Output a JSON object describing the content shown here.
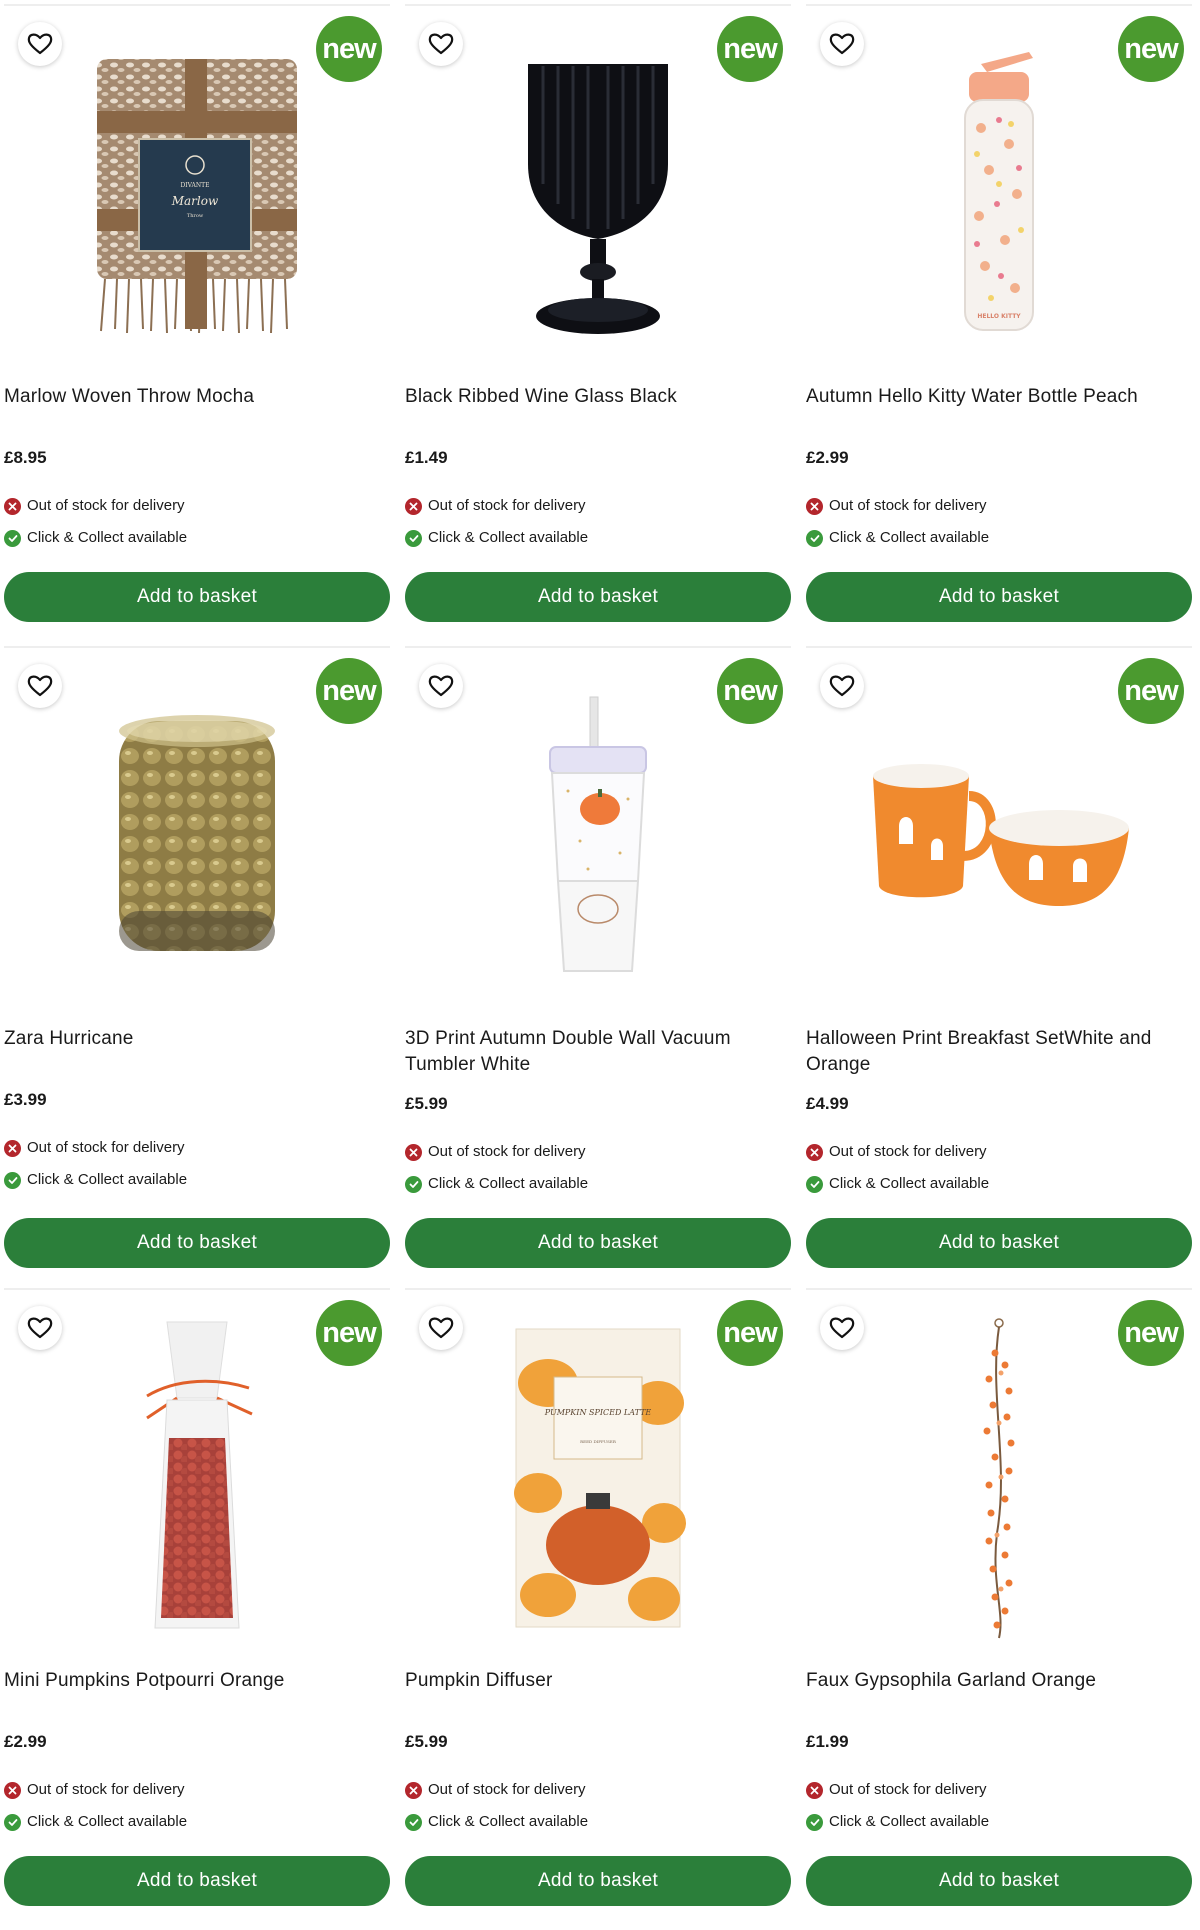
{
  "colors": {
    "badge": "#4b9a2f",
    "button": "#2b7f3a",
    "out_of_stock": "#b3262c",
    "available": "#3a9a3c"
  },
  "products": [
    {
      "title": "Marlow Woven Throw Mocha",
      "price": "£8.95",
      "badge": "new",
      "delivery": "Out of stock for delivery",
      "collect": "Click & Collect available",
      "button": "Add to basket",
      "image": "woven-throw",
      "packaging_brand": "DIVANTE",
      "packaging_name": "Marlow",
      "packaging_type": "Throw"
    },
    {
      "title": "Black Ribbed Wine Glass Black",
      "price": "£1.49",
      "badge": "new",
      "delivery": "Out of stock for delivery",
      "collect": "Click & Collect available",
      "button": "Add to basket",
      "image": "wine-glass"
    },
    {
      "title": "Autumn Hello Kitty Water Bottle Peach",
      "price": "£2.99",
      "badge": "new",
      "delivery": "Out of stock for delivery",
      "collect": "Click & Collect available",
      "button": "Add to basket",
      "image": "water-bottle",
      "bottle_print": "HELLO KITTY"
    },
    {
      "title": "Zara Hurricane",
      "price": "£3.99",
      "badge": "new",
      "delivery": "Out of stock for delivery",
      "collect": "Click & Collect available",
      "button": "Add to basket",
      "image": "hurricane-glass"
    },
    {
      "title": "3D Print Autumn Double Wall Vacuum Tumbler White",
      "price": "£5.99",
      "badge": "new",
      "delivery": "Out of stock for delivery",
      "collect": "Click & Collect available",
      "button": "Add to basket",
      "image": "tumbler"
    },
    {
      "title": "Halloween Print Breakfast SetWhite and Orange",
      "price": "£4.99",
      "badge": "new",
      "delivery": "Out of stock for delivery",
      "collect": "Click & Collect available",
      "button": "Add to basket",
      "image": "breakfast-set"
    },
    {
      "title": "Mini Pumpkins Potpourri Orange",
      "price": "£2.99",
      "badge": "new",
      "delivery": "Out of stock for delivery",
      "collect": "Click & Collect available",
      "button": "Add to basket",
      "image": "potpourri-bag"
    },
    {
      "title": "Pumpkin Diffuser",
      "price": "£5.99",
      "badge": "new",
      "delivery": "Out of stock for delivery",
      "collect": "Click & Collect available",
      "button": "Add to basket",
      "image": "diffuser-box",
      "packaging_name": "PUMPKIN SPICED LATTE",
      "packaging_type": "REED DIFFUSER"
    },
    {
      "title": "Faux Gypsophila Garland Orange",
      "price": "£1.99",
      "badge": "new",
      "delivery": "Out of stock for delivery",
      "collect": "Click & Collect available",
      "button": "Add to basket",
      "image": "garland"
    }
  ]
}
